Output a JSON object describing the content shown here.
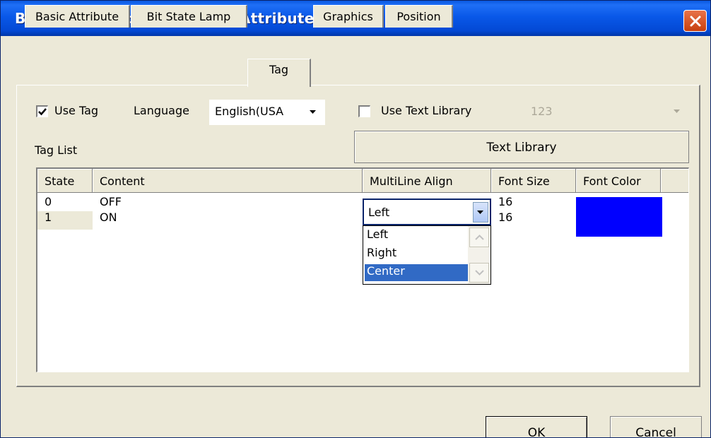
{
  "window": {
    "title": "Bit State Lamp Component Attribute"
  },
  "tabs": [
    {
      "label": "Basic Attribute"
    },
    {
      "label": "Bit State Lamp"
    },
    {
      "label": "Tag"
    },
    {
      "label": "Graphics"
    },
    {
      "label": "Position"
    }
  ],
  "active_tab": "Tag",
  "options": {
    "use_tag": {
      "label": "Use Tag",
      "checked": true
    },
    "language": {
      "label": "Language",
      "value": "English(USA"
    },
    "use_text_library": {
      "label": "Use Text Library",
      "checked": false
    },
    "text_library_combo": {
      "value": "123",
      "disabled": true
    },
    "text_library_button": "Text Library"
  },
  "tag_list": {
    "label": "Tag List",
    "columns": [
      "State",
      "Content",
      "MultiLine Align",
      "Font Size",
      "Font Color"
    ],
    "rows": [
      {
        "state": "0",
        "content": "OFF",
        "font_size": "16",
        "font_color": "#0000ff"
      },
      {
        "state": "1",
        "content": "ON",
        "font_size": "16",
        "font_color": "#0000ff"
      }
    ]
  },
  "align_dropdown": {
    "value": "Left",
    "options": [
      "Left",
      "Right",
      "Center"
    ],
    "highlighted": "Center"
  },
  "footer": {
    "ok": "OK",
    "cancel": "Cancel"
  },
  "colors": {
    "title_bar": "#0958e8",
    "selection": "#316ac5",
    "font_color_swatch": "#0000ff"
  }
}
